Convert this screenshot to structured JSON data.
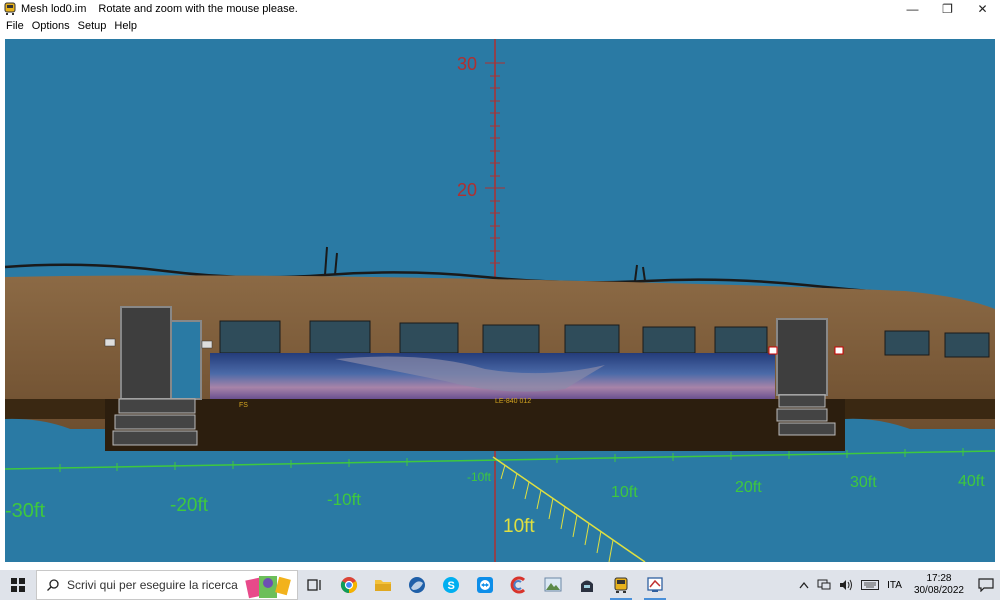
{
  "window": {
    "title": "Mesh lod0.im",
    "message": "Rotate and zoom with the mouse please.",
    "minimize_label": "—",
    "restore_label": "❐",
    "close_label": "✕"
  },
  "menu": {
    "items": [
      "File",
      "Options",
      "Setup",
      "Help"
    ]
  },
  "viewport": {
    "background": "#2a7aa4",
    "vertical_axis_labels": [
      "30",
      "20"
    ],
    "horizontal_axis_labels": [
      "-30ft",
      "-20ft",
      "-10ft",
      "-10ft",
      "10ft",
      "20ft",
      "30ft",
      "40ft"
    ],
    "depth_axis_label": "10ft",
    "car_markings": {
      "left": "FS",
      "center": "LE-840 012"
    },
    "colors": {
      "vertical_axis": "#b03030",
      "horizontal_axis": "#3ec83e",
      "depth_axis": "#e0e040",
      "car_body": "#7a5a36"
    }
  },
  "taskbar": {
    "search_placeholder": "Scrivi qui per eseguire la ricerca",
    "language": "ITA",
    "time": "17:28",
    "date": "30/08/2022",
    "pinned_icons": [
      "task-view-icon",
      "chrome-icon",
      "file-explorer-icon",
      "browser-icon",
      "skype-icon",
      "teamviewer-icon",
      "ccleaner-icon",
      "image-viewer-icon",
      "game-icon",
      "train-simulator-icon",
      "shape-viewer-icon"
    ]
  }
}
